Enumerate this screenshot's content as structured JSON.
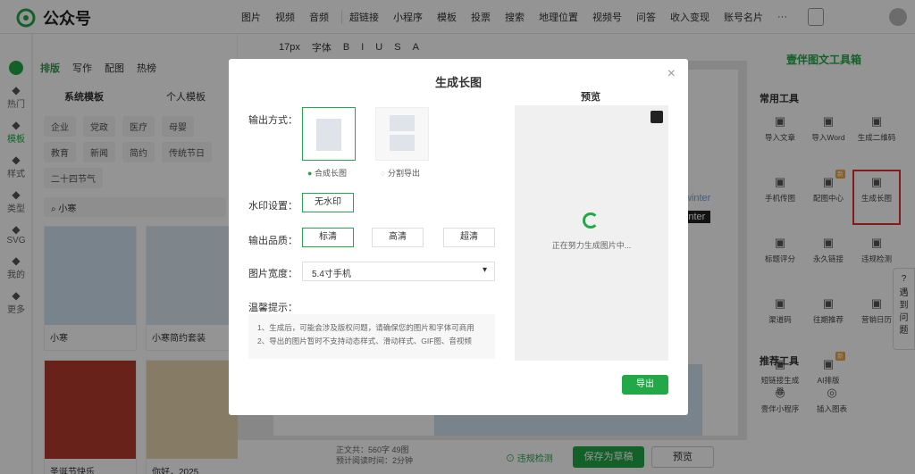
{
  "app": {
    "title": "公众号"
  },
  "menu": {
    "items": [
      "图片",
      "视频",
      "音频",
      "超链接",
      "小程序",
      "模板",
      "投票",
      "搜索",
      "地理位置",
      "视频号",
      "问答",
      "收入变现",
      "账号名片",
      "···"
    ]
  },
  "left_nav": [
    {
      "icon": "hot-icon",
      "label": "热门"
    },
    {
      "icon": "template-icon",
      "label": "模板"
    },
    {
      "icon": "style-icon",
      "label": "样式"
    },
    {
      "icon": "type-icon",
      "label": "类型"
    },
    {
      "icon": "svg-icon",
      "label": "SVG"
    },
    {
      "icon": "my-icon",
      "label": "我的"
    },
    {
      "icon": "more-icon",
      "label": "更多"
    }
  ],
  "template_panel": {
    "tabs": [
      "排版",
      "写作",
      "配图",
      "热榜"
    ],
    "subtabs": [
      "系统模板",
      "个人模板"
    ],
    "chips": [
      "企业",
      "党政",
      "医疗",
      "母婴",
      "教育",
      "新闻",
      "简约",
      "传统节日",
      "二十四节气"
    ],
    "search_value": "小寒",
    "cards": [
      {
        "label": "小寒"
      },
      {
        "label": "小寒简约套装"
      },
      {
        "label": "圣诞节快乐"
      },
      {
        "label": "你好，2025"
      }
    ]
  },
  "editor": {
    "toolbar": [
      "17px",
      "字体",
      "B",
      "I",
      "U",
      "S",
      "A"
    ],
    "canvas_words": [
      "winter",
      "winter"
    ]
  },
  "bottom": {
    "chars_label": "正文共：",
    "chars_value": "560字 49图",
    "read_label": "预计阅读时间：",
    "read_value": "2分钟",
    "check": "违规检测",
    "save": "保存为草稿",
    "preview": "预览"
  },
  "right_panel": {
    "title": "壹伴图文工具箱",
    "common_title": "常用工具",
    "tools": [
      {
        "label": "导入文章",
        "icon": "import-icon"
      },
      {
        "label": "导入Word",
        "icon": "word-icon"
      },
      {
        "label": "生成二维码",
        "icon": "qrcode-icon"
      },
      {
        "label": "手机传图",
        "icon": "phone-upload-icon"
      },
      {
        "label": "配图中心",
        "icon": "image-center-icon",
        "badge": "新"
      },
      {
        "label": "生成长图",
        "icon": "long-image-icon",
        "highlight": true
      },
      {
        "label": "标题评分",
        "icon": "title-score-icon"
      },
      {
        "label": "永久链接",
        "icon": "link-icon"
      },
      {
        "label": "违规检测",
        "icon": "violation-icon"
      },
      {
        "label": "渠道码",
        "icon": "channel-code-icon"
      },
      {
        "label": "往期推荐",
        "icon": "recommend-icon"
      },
      {
        "label": "营销日历",
        "icon": "calendar-icon"
      },
      {
        "label": "短链接生成器",
        "icon": "short-link-icon"
      },
      {
        "label": "AI排版",
        "icon": "ai-layout-icon",
        "badge": "新"
      }
    ],
    "recommend_title": "推荐工具",
    "recommend": [
      {
        "label": "壹伴小程序",
        "icon": "miniprogram-icon"
      },
      {
        "label": "插入图表",
        "icon": "chart-icon"
      }
    ]
  },
  "help": {
    "text": "遇到问题"
  },
  "modal": {
    "title": "生成长图",
    "output_label": "输出方式：",
    "output_options": [
      "合成长图",
      "分割导出"
    ],
    "watermark_label": "水印设置：",
    "watermark_value": "无水印",
    "quality_label": "输出品质：",
    "quality_options": [
      "标清",
      "高清",
      "超清"
    ],
    "width_label": "图片宽度：",
    "width_value": "5.4寸手机",
    "tips_label": "温馨提示：",
    "tips": [
      "1、生成后，可能会涉及版权问题，请确保您的图片和字体可商用",
      "2、导出的图片暂时不支持动态样式、滑动样式、GIF图、音视频"
    ],
    "preview_title": "预览",
    "loading_text": "正在努力生成图片中...",
    "export_label": "导出"
  },
  "colors": {
    "brand": "#22a846",
    "highlight": "#e0302e"
  }
}
